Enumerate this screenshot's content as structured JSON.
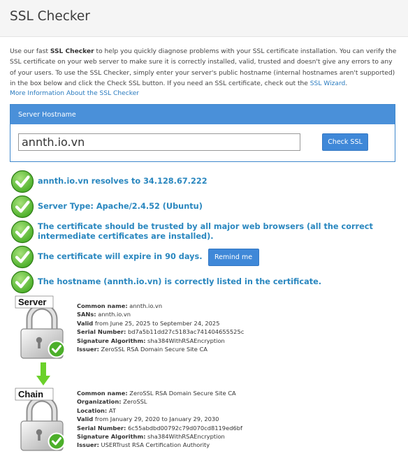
{
  "page": {
    "title": "SSL Checker"
  },
  "intro": {
    "part1": "Use our fast ",
    "bold": "SSL Checker",
    "part2": " to help you quickly diagnose problems with your SSL certificate installation. You can verify the SSL certificate on your web server to make sure it is correctly installed, valid, trusted and doesn't give any errors to any of your users. To use the SSL Checker, simply enter your server's public hostname (internal hostnames aren't supported) in the box below and click the Check SSL button. If you need an SSL certificate, check out the ",
    "link": "SSL Wizard",
    "part3": "."
  },
  "more_info_link": "More Information About the SSL Checker",
  "form": {
    "header": "Server Hostname",
    "hostname_value": "annth.io.vn",
    "check_button": "Check SSL"
  },
  "results": [
    {
      "text": "annth.io.vn resolves to 34.128.67.222"
    },
    {
      "text": "Server Type: Apache/2.4.52 (Ubuntu)"
    },
    {
      "text": "The certificate should be trusted by all major web browsers (all the correct intermediate certificates are installed)."
    },
    {
      "text": "The certificate will expire in 90 days.",
      "button": "Remind me"
    },
    {
      "text": "The hostname (annth.io.vn) is correctly listed in the certificate."
    }
  ],
  "server_cert": {
    "badge": "Server",
    "fields": [
      {
        "label": "Common name:",
        "value": "annth.io.vn"
      },
      {
        "label": "SANs:",
        "value": "annth.io.vn"
      },
      {
        "label": "Valid",
        "value": "from June 25, 2025 to September 24, 2025"
      },
      {
        "label": "Serial Number:",
        "value": "bd7a5b11dd27c5183ac741404655525c"
      },
      {
        "label": "Signature Algorithm:",
        "value": "sha384WithRSAEncryption"
      },
      {
        "label": "Issuer:",
        "value": "ZeroSSL RSA Domain Secure Site CA"
      }
    ]
  },
  "chain_cert": {
    "badge": "Chain",
    "fields": [
      {
        "label": "Common name:",
        "value": "ZeroSSL RSA Domain Secure Site CA"
      },
      {
        "label": "Organization:",
        "value": "ZeroSSL"
      },
      {
        "label": "Location:",
        "value": "AT"
      },
      {
        "label": "Valid",
        "value": "from January 29, 2020 to January 29, 2030"
      },
      {
        "label": "Serial Number:",
        "value": "6c55abdbd00792c79d070cd8119ed6bf"
      },
      {
        "label": "Signature Algorithm:",
        "value": "sha384WithRSAEncryption"
      },
      {
        "label": "Issuer:",
        "value": "USERTrust RSA Certification Authority"
      }
    ]
  },
  "icons": {
    "result": "green-check-icon",
    "certificate": "padlock-check-icon",
    "chain_link": "green-down-arrow-icon"
  },
  "colors": {
    "accent": "#2a87bf",
    "panel": "#4a90d9",
    "check_green": "#4caf2a"
  }
}
